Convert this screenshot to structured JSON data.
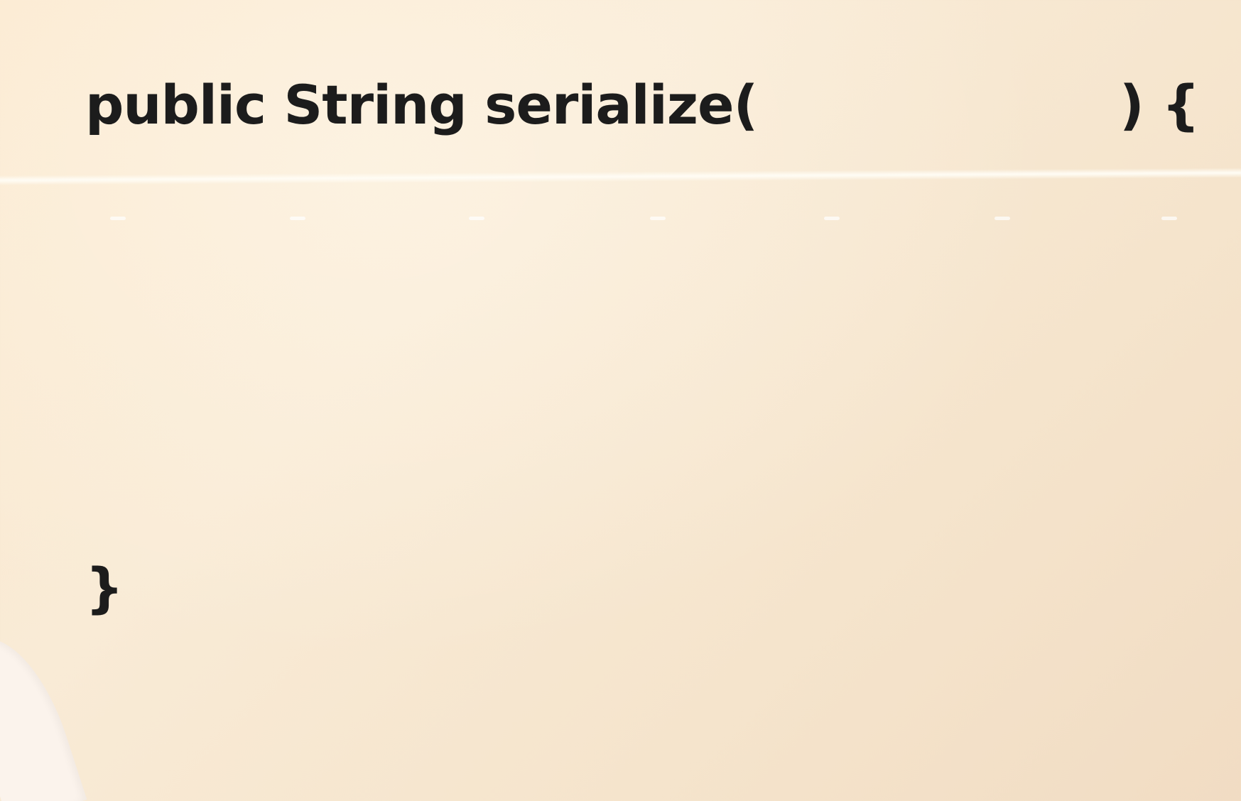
{
  "code": {
    "signature_start": "public String serialize(",
    "signature_end": ") {",
    "closing_brace": "}"
  }
}
